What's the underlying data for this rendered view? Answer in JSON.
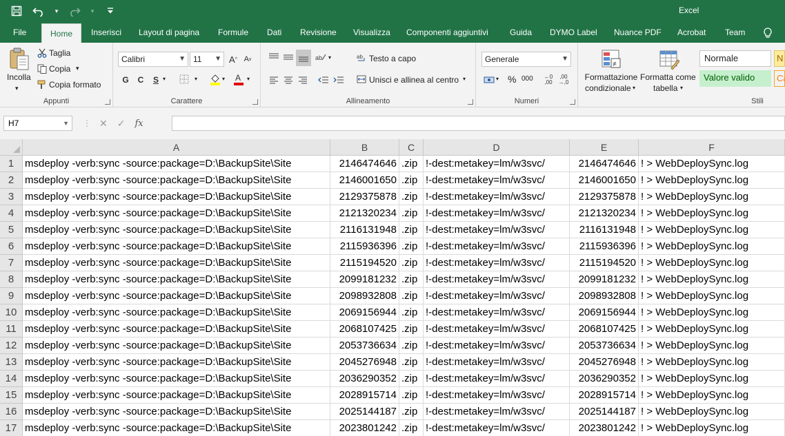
{
  "app": {
    "title": "Excel",
    "accent_color": "#217346"
  },
  "qat": {
    "save_icon": "save-icon",
    "undo_icon": "undo-icon",
    "redo_icon": "redo-icon",
    "customize_icon": "customize-qat-icon"
  },
  "tabs": [
    "File",
    "Home",
    "Inserisci",
    "Layout di pagina",
    "Formule",
    "Dati",
    "Revisione",
    "Visualizza",
    "Componenti aggiuntivi",
    "Guida",
    "DYMO Label",
    "Nuance PDF",
    "Acrobat",
    "Team"
  ],
  "active_tab": "Home",
  "ribbon": {
    "appunti": {
      "label": "Appunti",
      "paste": "Incolla",
      "cut": "Taglia",
      "copy": "Copia",
      "format_painter": "Copia formato"
    },
    "carattere": {
      "label": "Carattere",
      "font_name": "Calibri",
      "font_size": "11",
      "bold": "G",
      "italic": "C",
      "underline": "S",
      "font_color": "#e00000",
      "fill_color": "#ffff00"
    },
    "allineamento": {
      "label": "Allineamento",
      "wrap_text": "Testo a capo",
      "merge_center": "Unisci e allinea al centro"
    },
    "numeri": {
      "label": "Numeri",
      "format": "Generale",
      "percent": "%",
      "thousands": "000"
    },
    "stili": {
      "label": "Stili",
      "conditional_1": "Formattazione",
      "conditional_2": "condizionale",
      "table_1": "Formatta come",
      "table_2": "tabella",
      "style_normal": "Normale",
      "style_good": "Valore valido",
      "style_neutral_partial": "N",
      "style_calc_partial": "Ca"
    }
  },
  "formula_bar": {
    "name_box": "H7",
    "fx": "fx",
    "formula": ""
  },
  "sheet": {
    "columns": [
      "A",
      "B",
      "C",
      "D",
      "E",
      "F"
    ],
    "rows": [
      {
        "num": "1",
        "a": "msdeploy -verb:sync -source:package=D:\\BackupSite\\Site",
        "b": "2146474646",
        "c": ".zip",
        "d": "!-dest:metakey=lm/w3svc/",
        "e": "2146474646",
        "f": "! > WebDeploySync.log"
      },
      {
        "num": "2",
        "a": "msdeploy -verb:sync -source:package=D:\\BackupSite\\Site",
        "b": "2146001650",
        "c": ".zip",
        "d": "!-dest:metakey=lm/w3svc/",
        "e": "2146001650",
        "f": "! > WebDeploySync.log"
      },
      {
        "num": "3",
        "a": "msdeploy -verb:sync -source:package=D:\\BackupSite\\Site",
        "b": "2129375878",
        "c": ".zip",
        "d": "!-dest:metakey=lm/w3svc/",
        "e": "2129375878",
        "f": "! > WebDeploySync.log"
      },
      {
        "num": "4",
        "a": "msdeploy -verb:sync -source:package=D:\\BackupSite\\Site",
        "b": "2121320234",
        "c": ".zip",
        "d": "!-dest:metakey=lm/w3svc/",
        "e": "2121320234",
        "f": "! > WebDeploySync.log"
      },
      {
        "num": "5",
        "a": "msdeploy -verb:sync -source:package=D:\\BackupSite\\Site",
        "b": "2116131948",
        "c": ".zip",
        "d": "!-dest:metakey=lm/w3svc/",
        "e": "2116131948",
        "f": "! > WebDeploySync.log"
      },
      {
        "num": "6",
        "a": "msdeploy -verb:sync -source:package=D:\\BackupSite\\Site",
        "b": "2115936396",
        "c": ".zip",
        "d": "!-dest:metakey=lm/w3svc/",
        "e": "2115936396",
        "f": "! > WebDeploySync.log"
      },
      {
        "num": "7",
        "a": "msdeploy -verb:sync -source:package=D:\\BackupSite\\Site",
        "b": "2115194520",
        "c": ".zip",
        "d": "!-dest:metakey=lm/w3svc/",
        "e": "2115194520",
        "f": "! > WebDeploySync.log"
      },
      {
        "num": "8",
        "a": "msdeploy -verb:sync -source:package=D:\\BackupSite\\Site",
        "b": "2099181232",
        "c": ".zip",
        "d": "!-dest:metakey=lm/w3svc/",
        "e": "2099181232",
        "f": "! > WebDeploySync.log"
      },
      {
        "num": "9",
        "a": "msdeploy -verb:sync -source:package=D:\\BackupSite\\Site",
        "b": "2098932808",
        "c": ".zip",
        "d": "!-dest:metakey=lm/w3svc/",
        "e": "2098932808",
        "f": "! > WebDeploySync.log"
      },
      {
        "num": "10",
        "a": "msdeploy -verb:sync -source:package=D:\\BackupSite\\Site",
        "b": "2069156944",
        "c": ".zip",
        "d": "!-dest:metakey=lm/w3svc/",
        "e": "2069156944",
        "f": "! > WebDeploySync.log"
      },
      {
        "num": "11",
        "a": "msdeploy -verb:sync -source:package=D:\\BackupSite\\Site",
        "b": "2068107425",
        "c": ".zip",
        "d": "!-dest:metakey=lm/w3svc/",
        "e": "2068107425",
        "f": "! > WebDeploySync.log"
      },
      {
        "num": "12",
        "a": "msdeploy -verb:sync -source:package=D:\\BackupSite\\Site",
        "b": "2053736634",
        "c": ".zip",
        "d": "!-dest:metakey=lm/w3svc/",
        "e": "2053736634",
        "f": "! > WebDeploySync.log"
      },
      {
        "num": "13",
        "a": "msdeploy -verb:sync -source:package=D:\\BackupSite\\Site",
        "b": "2045276948",
        "c": ".zip",
        "d": "!-dest:metakey=lm/w3svc/",
        "e": "2045276948",
        "f": "! > WebDeploySync.log"
      },
      {
        "num": "14",
        "a": "msdeploy -verb:sync -source:package=D:\\BackupSite\\Site",
        "b": "2036290352",
        "c": ".zip",
        "d": "!-dest:metakey=lm/w3svc/",
        "e": "2036290352",
        "f": "! > WebDeploySync.log"
      },
      {
        "num": "15",
        "a": "msdeploy -verb:sync -source:package=D:\\BackupSite\\Site",
        "b": "2028915714",
        "c": ".zip",
        "d": "!-dest:metakey=lm/w3svc/",
        "e": "2028915714",
        "f": "! > WebDeploySync.log"
      },
      {
        "num": "16",
        "a": "msdeploy -verb:sync -source:package=D:\\BackupSite\\Site",
        "b": "2025144187",
        "c": ".zip",
        "d": "!-dest:metakey=lm/w3svc/",
        "e": "2025144187",
        "f": "! > WebDeploySync.log"
      },
      {
        "num": "17",
        "a": "msdeploy -verb:sync -source:package=D:\\BackupSite\\Site",
        "b": "2023801242",
        "c": ".zip",
        "d": "!-dest:metakey=lm/w3svc/",
        "e": "2023801242",
        "f": "! > WebDeploySync.log"
      }
    ]
  }
}
